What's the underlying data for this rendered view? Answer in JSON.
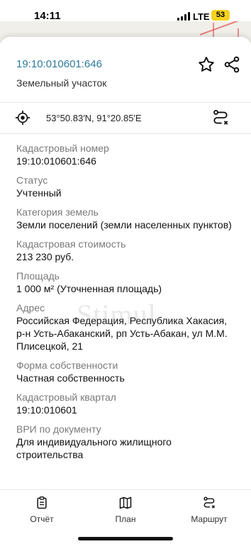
{
  "status_bar": {
    "time": "14:11",
    "network": "LTE",
    "battery": "53",
    "battery_color": "#f5d21f"
  },
  "header": {
    "cadastral_link": "19:10:010601:646",
    "object_type": "Земельный участок",
    "favorite_icon": "star-icon",
    "share_icon": "share-icon",
    "link_color": "#2c7a9a"
  },
  "location": {
    "coordinates": "53°50.83′N, 91°20.85′E",
    "locate_icon": "target-icon",
    "route_icon": "route-icon"
  },
  "fields": [
    {
      "label": "Кадастровый номер",
      "value": "19:10:010601:646"
    },
    {
      "label": "Статус",
      "value": "Учтенный"
    },
    {
      "label": "Категория земель",
      "value": "Земли поселений (земли населенных пунктов)"
    },
    {
      "label": "Кадастровая стоимость",
      "value": "213 230 руб."
    },
    {
      "label": "Площадь",
      "value": "1 000 м² (Уточненная площадь)"
    },
    {
      "label": "Адрес",
      "value": "Российская Федерация, Республика Хакасия, р-н Усть-Абаканский, рп Усть-Абакан, ул М.М. Плисецкой, 21"
    },
    {
      "label": "Форма собственности",
      "value": "Частная собственность"
    },
    {
      "label": "Кадастровый квартал",
      "value": "19:10:010601"
    },
    {
      "label": "ВРИ по документу",
      "value": "Для индивидуального жилищного строительства"
    }
  ],
  "watermark": "Stimul",
  "bottom_nav": [
    {
      "label": "Отчёт",
      "icon": "report-icon"
    },
    {
      "label": "План",
      "icon": "map-icon"
    },
    {
      "label": "Маршрут",
      "icon": "route-icon"
    }
  ]
}
